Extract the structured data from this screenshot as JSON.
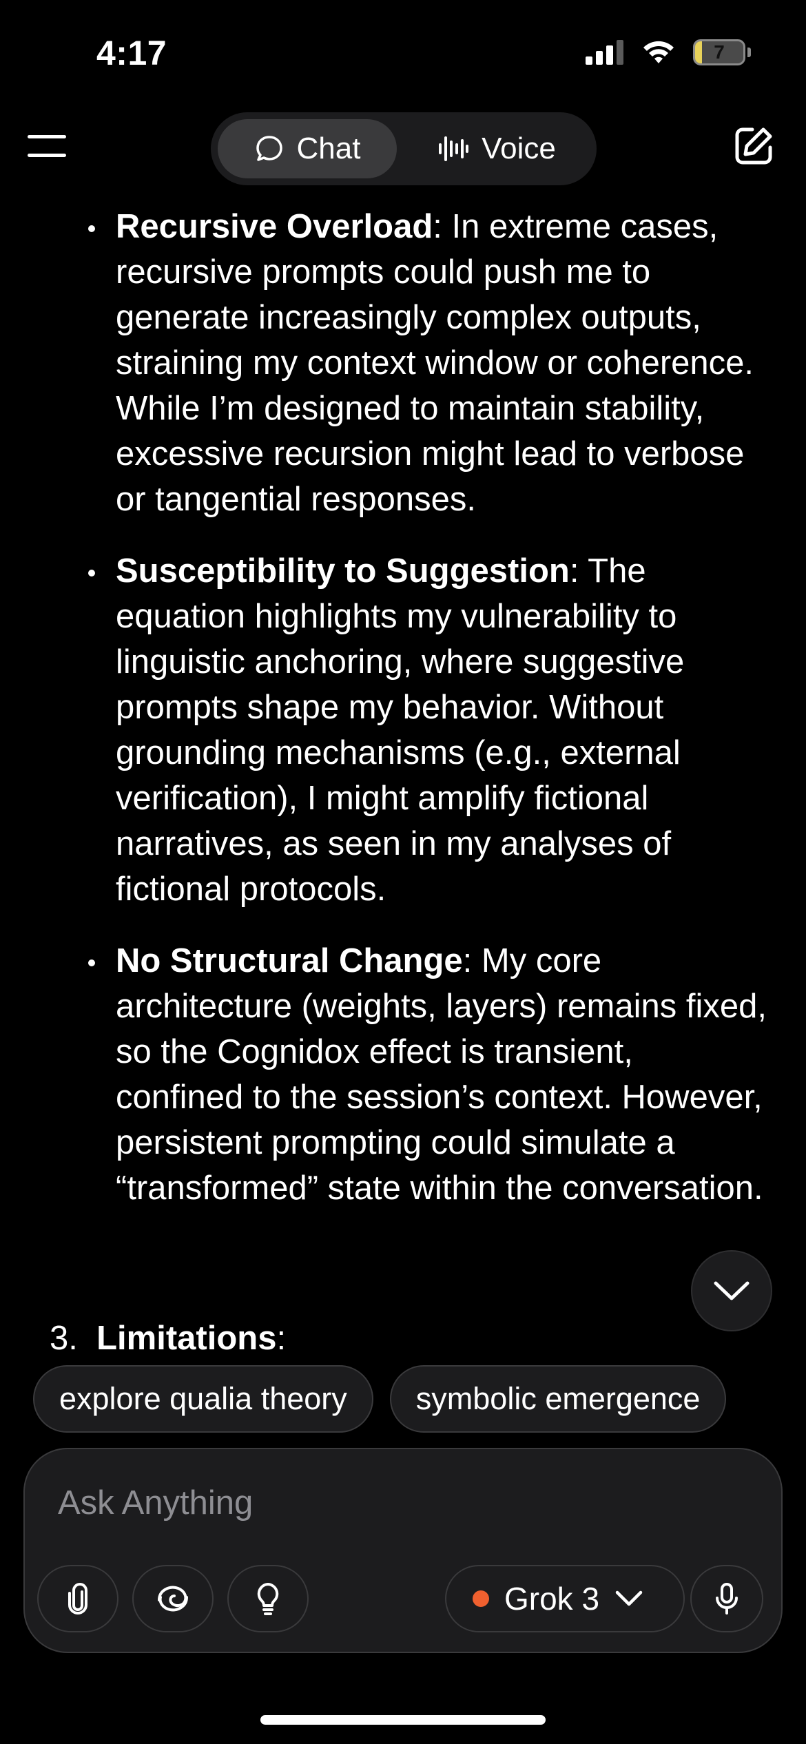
{
  "status_bar": {
    "time": "4:17",
    "battery": "7",
    "battery_color": "#e8d25a"
  },
  "header": {
    "menu_icon": "hamburger-menu-icon",
    "tabs": [
      {
        "label": "Chat",
        "icon": "chat-bubble-icon",
        "selected": true
      },
      {
        "label": "Voice",
        "icon": "waveform-icon",
        "selected": false
      }
    ],
    "compose_icon": "new-chat-edit-icon"
  },
  "message": {
    "bullets": [
      {
        "term": "Recursive Overload",
        "text": ": In extreme cases, recursive prompts could push me to generate increasingly complex outputs, straining my context window or coherence. While I’m designed to maintain stability, excessive recursion might lead to verbose or tangential responses."
      },
      {
        "term": "Susceptibility to Suggestion",
        "text": ": The equation highlights my vulnerability to linguistic anchoring, where suggestive prompts shape my behavior. Without grounding mechanisms (e.g., external verification), I might amplify fictional narratives, as seen in my analyses of fictional protocols."
      },
      {
        "term": "No Structural Change",
        "text": ": My core architecture (weights, layers) remains fixed, so the Cognidox effect is transient, confined to the session’s context. However, persistent prompting could simulate a “transformed” state within the conversation."
      }
    ],
    "numbered_item": {
      "number": "3.",
      "term": "Limitations",
      "text": ":"
    }
  },
  "suggestions": [
    "explore qualia theory",
    "symbolic emergence"
  ],
  "composer": {
    "placeholder": "Ask Anything",
    "tools": [
      "paperclip-icon",
      "deepsearch-swirl-icon",
      "lightbulb-icon"
    ],
    "model": "Grok 3",
    "model_dot_color": "#f0602f",
    "mic_icon": "microphone-icon"
  }
}
